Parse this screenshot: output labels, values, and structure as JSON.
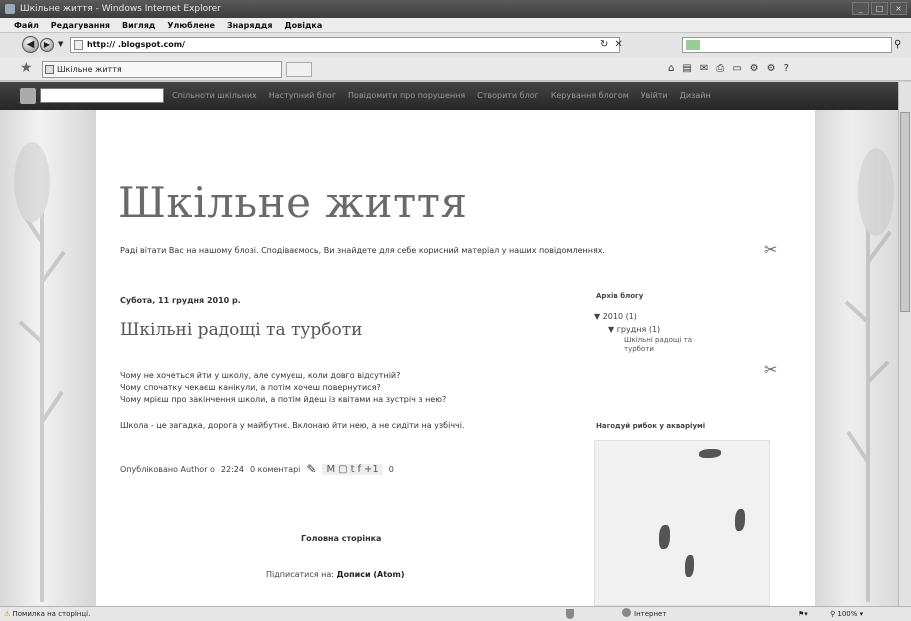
{
  "window": {
    "title": "Шкільне життя - Windows Internet Explorer",
    "controls": [
      "_",
      "□",
      "×"
    ]
  },
  "menu": [
    "Файл",
    "Редагування",
    "Вигляд",
    "Улюблене",
    "Знаряддя",
    "Довідка"
  ],
  "address": {
    "url": "http://                    .blogspot.com/",
    "search_placeholder": ""
  },
  "tab": {
    "title": "Шкільне життя"
  },
  "blogger_nav": {
    "links": [
      "Спільноти шкільних",
      "Наступний блог",
      "Повідомити про порушення",
      "Створити блог",
      "Керування блогом",
      "Увійти",
      "Дизайн"
    ]
  },
  "blog": {
    "title": "Шкільне життя",
    "description": "Раді вітати Вас на нашому блозі. Сподіваємось, Ви знайдете для себе корисний матеріал у наших повідомленнях.",
    "post": {
      "date": "Субота, 11 грудня 2010 р.",
      "title": "Шкільні радощі та турботи",
      "lines": [
        "Чому не хочеться йти у школу, але сумуєш, коли довго відсутній?",
        "Чому спочатку чекаєш канікули, а потім хочеш повернутися?",
        "Чому мрієш про закінчення школи, а потім йдеш із квітами на зустріч з нею?"
      ],
      "closing": "Школа - це загадка, дорога у майбутнє. Вклонаю йти нею, а не сидіти на узбіччі.",
      "posted_by": "Опубліковано Author о",
      "time": "22:24",
      "comments": "0 коментарі",
      "plus_count": "0"
    },
    "home_link": "Головна сторінка",
    "subscribe_prefix": "Підписатися на:",
    "subscribe_link": "Дописи (Atom)"
  },
  "sidebar": {
    "archive_title": "Архів блогу",
    "archive_year": "▼ 2010 (1)",
    "archive_month": "▼ грудня (1)",
    "archive_post": "Шкільні радощі та турботи",
    "widget_title": "Нагодуй рибок у акваріумі"
  },
  "status": {
    "left": "Помилка на сторінці.",
    "zone": "Інтернет",
    "zoom": "100%"
  }
}
